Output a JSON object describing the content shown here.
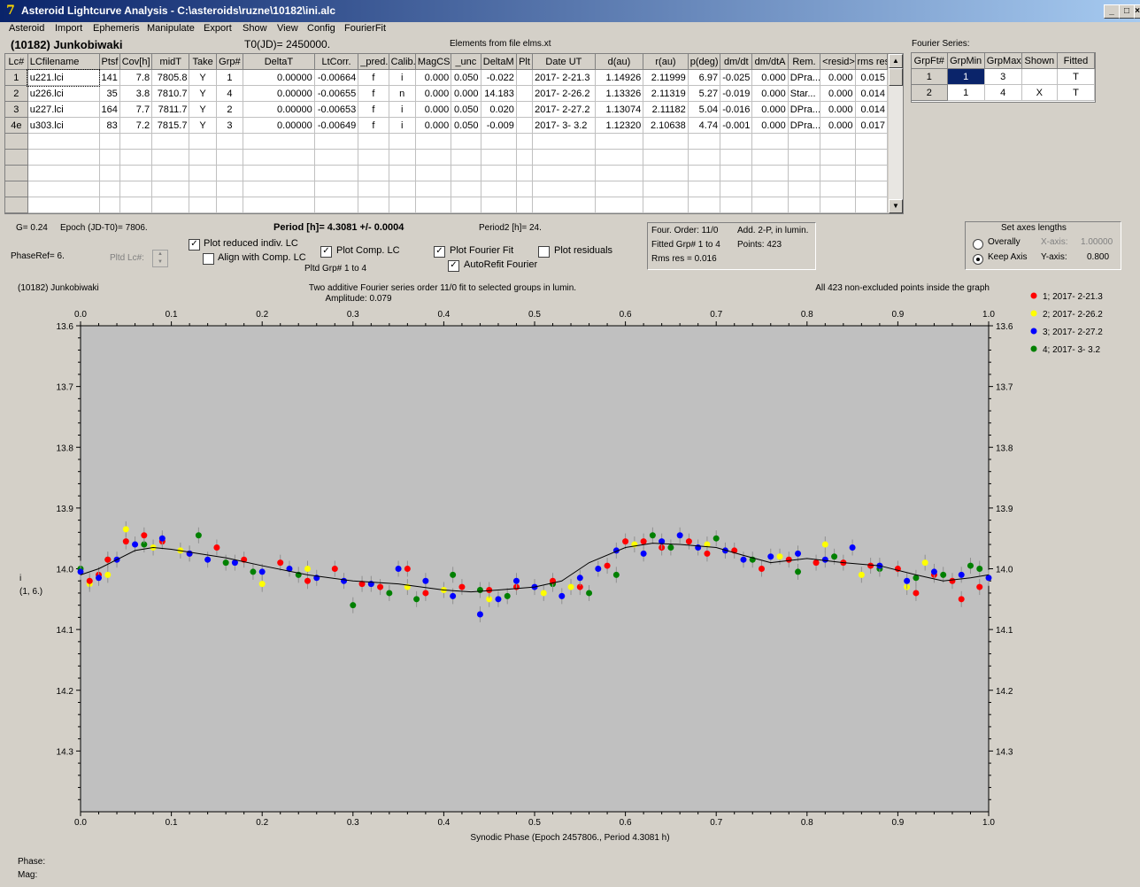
{
  "window": {
    "title": "Asteroid Lightcurve Analysis - C:\\asteroids\\ruzne\\10182\\ini.alc",
    "icon": "app-icon"
  },
  "menu": [
    "Asteroid",
    "Import",
    "Ephemeris",
    "Manipulate",
    "Export",
    "Show",
    "View",
    "Config",
    "FourierFit"
  ],
  "header": {
    "asteroid": "(10182) Junkobiwaki",
    "t0": "T0(JD)= 2450000.",
    "elements": "Elements from file elms.xt"
  },
  "lc_grid": {
    "columns": [
      "Lc#",
      "LCfilename",
      "Ptsf",
      "Cov[h]",
      "midT",
      "Take",
      "Grp#",
      "DeltaT",
      "LtCorr.",
      "_pred.",
      "Calib.",
      "MagCS",
      "_unc",
      "DeltaM",
      "Plt",
      "Date UT",
      "d(au)",
      "r(au)",
      "p(deg)",
      "dm/dt",
      "dm/dtA",
      "Rem.",
      "<resid>",
      "rms res"
    ],
    "rows": [
      [
        "1",
        "u221.lci",
        "141",
        "7.8",
        "7805.8",
        "Y",
        "1",
        "0.00000",
        "-0.00664",
        "f",
        "i",
        "0.000",
        "0.050",
        "-0.022",
        "",
        "2017- 2-21.3",
        "1.14926",
        "2.11999",
        "6.97",
        "-0.025",
        "0.000",
        "DPra...",
        "0.000",
        "0.015"
      ],
      [
        "2",
        "u226.lci",
        "35",
        "3.8",
        "7810.7",
        "Y",
        "4",
        "0.00000",
        "-0.00655",
        "f",
        "n",
        "0.000",
        "0.000",
        "14.183",
        "",
        "2017- 2-26.2",
        "1.13326",
        "2.11319",
        "5.27",
        "-0.019",
        "0.000",
        "Star...",
        "0.000",
        "0.014"
      ],
      [
        "3",
        "u227.lci",
        "164",
        "7.7",
        "7811.7",
        "Y",
        "2",
        "0.00000",
        "-0.00653",
        "f",
        "i",
        "0.000",
        "0.050",
        "0.020",
        "",
        "2017- 2-27.2",
        "1.13074",
        "2.11182",
        "5.04",
        "-0.016",
        "0.000",
        "DPra...",
        "0.000",
        "0.014"
      ],
      [
        "4e",
        "u303.lci",
        "83",
        "7.2",
        "7815.7",
        "Y",
        "3",
        "0.00000",
        "-0.00649",
        "f",
        "i",
        "0.000",
        "0.050",
        "-0.009",
        "",
        "2017- 3- 3.2",
        "1.12320",
        "2.10638",
        "4.74",
        "-0.001",
        "0.000",
        "DPra...",
        "0.000",
        "0.017"
      ]
    ],
    "empty_rows": 5
  },
  "fourier_series": {
    "title": "Fourier Series:",
    "columns": [
      "GrpFt#",
      "GrpMin",
      "GrpMax",
      "Shown",
      "Fitted"
    ],
    "rows": [
      [
        "1",
        "1",
        "3",
        "",
        "T"
      ],
      [
        "2",
        "1",
        "4",
        "X",
        "T"
      ]
    ]
  },
  "params": {
    "g": "G= 0.24",
    "epoch": "Epoch (JD-T0)= 7806.",
    "period": "Period [h]= 4.3081 +/- 0.0004",
    "period2": "Period2 [h]= 24.",
    "phaseref": "PhaseRef= 6.",
    "pltd_lc": "Pltd Lc#:",
    "pltd_grp": "Pltd Grp#  1   to   4"
  },
  "checks": {
    "plot_reduced": {
      "label": "Plot reduced indiv. LC",
      "checked": true
    },
    "align_comp": {
      "label": "Align with Comp. LC",
      "checked": false
    },
    "plot_comp": {
      "label": "Plot Comp. LC",
      "checked": true
    },
    "plot_fourier": {
      "label": "Plot Fourier Fit",
      "checked": true
    },
    "plot_residuals": {
      "label": "Plot residuals",
      "checked": false
    },
    "autorefit": {
      "label": "AutoRefit Fourier",
      "checked": true
    }
  },
  "fit_info": {
    "order": "Four. Order: 11/0",
    "add": "Add. 2-P, in lumin.",
    "fitted": "Fitted Grp# 1 to 4",
    "points": "Points: 423",
    "rms": "Rms res     = 0.016"
  },
  "axes_panel": {
    "title": "Set axes lengths",
    "overally": "Overally",
    "keep": "Keep Axis",
    "xaxis_label": "X-axis:",
    "xaxis_value": "1.00000",
    "yaxis_label": "Y-axis:",
    "yaxis_value": "0.800"
  },
  "status": {
    "phase": "Phase:",
    "mag": "Mag:"
  },
  "colors": {
    "bg": "#c0c0c0",
    "g1": "#ff0000",
    "g2": "#ffff00",
    "g3": "#0000ff",
    "g4": "#008000"
  },
  "chart_data": {
    "type": "scatter",
    "title": "Two additive Fourier series order 11/0 fit to selected groups in lumin.",
    "subtitle": "Amplitude: 0.079",
    "left_title": "(10182) Junkobiwaki",
    "right_title": "All 423 non-excluded points inside the graph",
    "xlabel": "Synodic Phase (Epoch 2457806., Period 4.3081 h)",
    "ylabel": "i",
    "ylabel2": "(1, 6.)",
    "xlim": [
      0,
      1
    ],
    "ylim": [
      13.6,
      14.4
    ],
    "y_inverted": true,
    "xticks": [
      "0.0",
      "0.1",
      "0.2",
      "0.3",
      "0.4",
      "0.5",
      "0.6",
      "0.7",
      "0.8",
      "0.9",
      "1.0"
    ],
    "yticks": [
      "13.6",
      "13.7",
      "13.8",
      "13.9",
      "14.0",
      "14.1",
      "14.2",
      "14.3"
    ],
    "legend": [
      "1; 2017- 2-21.3",
      "2; 2017- 2-26.2",
      "3; 2017- 2-27.2",
      "4; 2017- 3- 3.2"
    ],
    "fit_curve": {
      "x": [
        0.0,
        0.02,
        0.04,
        0.06,
        0.08,
        0.1,
        0.13,
        0.16,
        0.2,
        0.25,
        0.3,
        0.35,
        0.4,
        0.43,
        0.46,
        0.5,
        0.53,
        0.56,
        0.6,
        0.63,
        0.66,
        0.7,
        0.73,
        0.76,
        0.8,
        0.84,
        0.88,
        0.92,
        0.95,
        0.98,
        1.0
      ],
      "y": [
        14.01,
        14.0,
        13.985,
        13.97,
        13.965,
        13.968,
        13.975,
        13.982,
        13.995,
        14.01,
        14.02,
        14.025,
        14.035,
        14.038,
        14.035,
        14.03,
        14.02,
        13.99,
        13.965,
        13.958,
        13.96,
        13.965,
        13.978,
        13.99,
        13.983,
        13.99,
        13.995,
        14.01,
        14.02,
        14.015,
        14.01
      ]
    },
    "series": [
      {
        "name": "1; 2017- 2-21.3",
        "x": [
          0.01,
          0.02,
          0.03,
          0.05,
          0.07,
          0.09,
          0.12,
          0.15,
          0.18,
          0.22,
          0.25,
          0.28,
          0.31,
          0.33,
          0.36,
          0.38,
          0.42,
          0.45,
          0.48,
          0.52,
          0.55,
          0.58,
          0.6,
          0.62,
          0.64,
          0.67,
          0.69,
          0.72,
          0.75,
          0.78,
          0.81,
          0.84,
          0.87,
          0.9,
          0.92,
          0.94,
          0.96,
          0.97,
          0.99
        ],
        "y": [
          14.02,
          14.01,
          13.985,
          13.955,
          13.945,
          13.955,
          13.975,
          13.965,
          13.985,
          13.99,
          14.02,
          14.0,
          14.025,
          14.03,
          14.0,
          14.04,
          14.03,
          14.035,
          14.03,
          14.02,
          14.03,
          13.995,
          13.955,
          13.955,
          13.965,
          13.955,
          13.975,
          13.97,
          14.0,
          13.985,
          13.99,
          13.99,
          13.995,
          14.0,
          14.04,
          14.01,
          14.02,
          14.05,
          14.03
        ]
      },
      {
        "name": "2; 2017- 2-26.2",
        "x": [
          0.01,
          0.03,
          0.05,
          0.08,
          0.11,
          0.2,
          0.25,
          0.36,
          0.4,
          0.45,
          0.51,
          0.54,
          0.61,
          0.69,
          0.71,
          0.77,
          0.82,
          0.86,
          0.91,
          0.93
        ],
        "y": [
          14.025,
          14.01,
          13.935,
          13.965,
          13.97,
          14.025,
          14.0,
          14.03,
          14.035,
          14.05,
          14.04,
          14.03,
          13.96,
          13.96,
          13.97,
          13.98,
          13.96,
          14.01,
          14.03,
          13.99
        ]
      },
      {
        "name": "3; 2017- 2-27.2",
        "x": [
          0.0,
          0.02,
          0.04,
          0.06,
          0.09,
          0.12,
          0.14,
          0.17,
          0.2,
          0.23,
          0.26,
          0.29,
          0.32,
          0.35,
          0.38,
          0.41,
          0.44,
          0.46,
          0.48,
          0.5,
          0.53,
          0.55,
          0.57,
          0.59,
          0.62,
          0.64,
          0.66,
          0.68,
          0.71,
          0.73,
          0.76,
          0.79,
          0.82,
          0.85,
          0.88,
          0.91,
          0.94,
          0.97,
          1.0
        ],
        "y": [
          14.005,
          14.015,
          13.985,
          13.96,
          13.95,
          13.975,
          13.985,
          13.99,
          14.005,
          14.0,
          14.015,
          14.02,
          14.025,
          14.0,
          14.02,
          14.045,
          14.075,
          14.05,
          14.02,
          14.03,
          14.045,
          14.015,
          14.0,
          13.97,
          13.975,
          13.955,
          13.945,
          13.965,
          13.97,
          13.985,
          13.98,
          13.975,
          13.985,
          13.965,
          13.995,
          14.02,
          14.005,
          14.01,
          14.015
        ]
      },
      {
        "name": "4; 2017- 3- 3.2",
        "x": [
          0.0,
          0.03,
          0.07,
          0.13,
          0.16,
          0.19,
          0.24,
          0.3,
          0.34,
          0.37,
          0.41,
          0.44,
          0.47,
          0.52,
          0.56,
          0.59,
          0.63,
          0.65,
          0.7,
          0.74,
          0.79,
          0.83,
          0.88,
          0.92,
          0.95,
          0.98,
          0.99
        ],
        "y": [
          14.0,
          13.985,
          13.96,
          13.945,
          13.99,
          14.005,
          14.01,
          14.06,
          14.04,
          14.05,
          14.01,
          14.035,
          14.045,
          14.025,
          14.04,
          14.01,
          13.945,
          13.965,
          13.95,
          13.985,
          14.005,
          13.98,
          14.0,
          14.015,
          14.01,
          13.995,
          14.0
        ]
      }
    ]
  }
}
